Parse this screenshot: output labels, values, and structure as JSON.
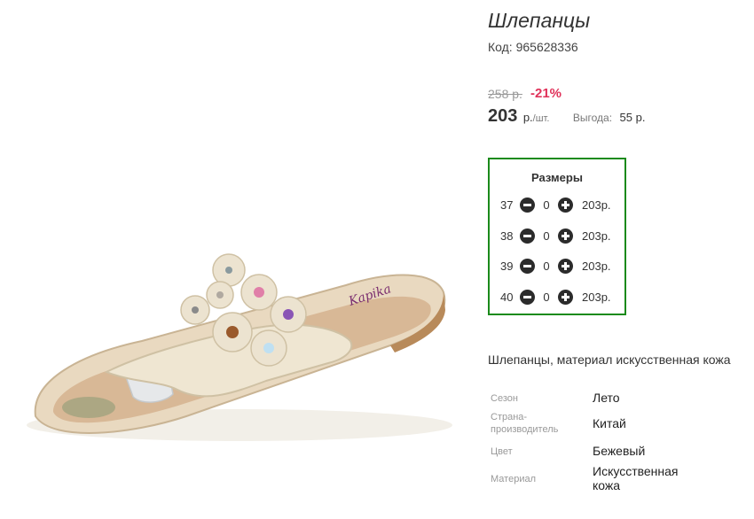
{
  "product": {
    "title": "Шлепанцы",
    "code": "Код: 965628336",
    "old_price": "258 р.",
    "discount": "-21%",
    "price": "203",
    "price_unit": "р.",
    "price_unit_sub": "/шт.",
    "benefit_label": "Выгода:",
    "benefit_value": "55 р."
  },
  "sizes": {
    "title": "Размеры",
    "rows": [
      {
        "size": "37",
        "qty": "0",
        "price": "203р."
      },
      {
        "size": "38",
        "qty": "0",
        "price": "203р."
      },
      {
        "size": "39",
        "qty": "0",
        "price": "203р."
      },
      {
        "size": "40",
        "qty": "0",
        "price": "203р."
      }
    ]
  },
  "description": "Шлепанцы, материал искусственная кожа",
  "specs": [
    {
      "label": "Сезон",
      "value": "Лето"
    },
    {
      "label": "Страна-производитель",
      "value": "Китай"
    },
    {
      "label": "Цвет",
      "value": "Бежевый"
    },
    {
      "label": "Материал",
      "value": "Искусственная кожа"
    }
  ],
  "colors": {
    "accent_border": "#1a8a1a",
    "discount": "#e0325a",
    "button": "#2b2b2b"
  },
  "icons": {
    "minus": "minus-circle-icon",
    "plus": "plus-circle-icon"
  }
}
